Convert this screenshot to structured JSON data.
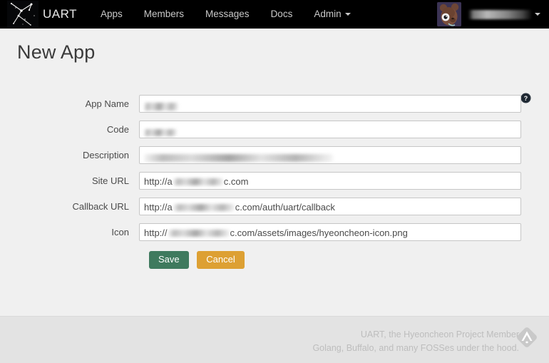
{
  "navbar": {
    "logo_icon": "constellation-logo-icon",
    "brand": "UART",
    "links": [
      {
        "label": "Apps"
      },
      {
        "label": "Members"
      },
      {
        "label": "Messages"
      },
      {
        "label": "Docs"
      },
      {
        "label": "Admin",
        "has_caret": true
      }
    ],
    "avatar_icon": "teddy-bear-avatar",
    "username": "",
    "username_redacted": true,
    "user_caret_icon": "chevron-down-icon",
    "background_color": "#000000",
    "link_color": "#c9c9c9"
  },
  "page": {
    "title": "New App",
    "help_icon": "help-question-circle-icon",
    "background_color": "#f0f0f0"
  },
  "form": {
    "fields": [
      {
        "name": "app-name",
        "label": "App Name",
        "value": "",
        "redacted": true,
        "redact_class": "redact-name",
        "placeholder": ""
      },
      {
        "name": "code",
        "label": "Code",
        "value": "",
        "redacted": true,
        "redact_class": "redact-code",
        "placeholder": ""
      },
      {
        "name": "description",
        "label": "Description",
        "value": "",
        "redacted": true,
        "redact_class": "redact-desc",
        "placeholder": ""
      },
      {
        "name": "site-url",
        "label": "Site URL",
        "prefix": "http://a",
        "suffix": "c.com",
        "partial_redacted": true,
        "placeholder": ""
      },
      {
        "name": "callback-url",
        "label": "Callback URL",
        "prefix": "http://a",
        "suffix": "c.com/auth/uart/callback",
        "partial_redacted": true,
        "placeholder": ""
      },
      {
        "name": "icon",
        "label": "Icon",
        "prefix": "http://",
        "suffix": "c.com/assets/images/hyeoncheon-icon.png",
        "partial_redacted": true,
        "placeholder": ""
      }
    ],
    "buttons": {
      "save_label": "Save",
      "save_color": "#3f7a5e",
      "cancel_label": "Cancel",
      "cancel_color": "#dda033"
    }
  },
  "footer": {
    "line1": "UART, the Hyeoncheon Project Member",
    "line2": "Golang, Buffalo, and many FOSSes under the hood.",
    "badge_icon": "feedly-diamond-badge-icon",
    "text_color": "#bdbdbd",
    "background_color": "#e3e3e3"
  }
}
